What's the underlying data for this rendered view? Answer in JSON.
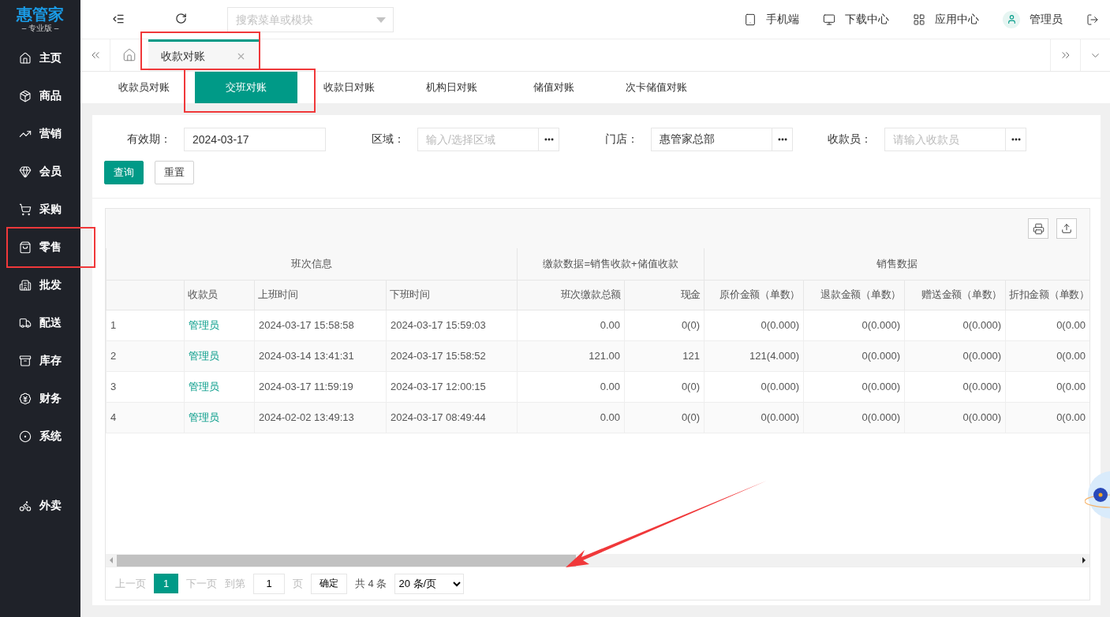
{
  "brand": {
    "name": "惠管家",
    "edition": "– 专业版 –"
  },
  "sidebar": {
    "items": [
      {
        "label": "主页",
        "highlighted": false
      },
      {
        "label": "商品",
        "highlighted": false
      },
      {
        "label": "营销",
        "highlighted": false
      },
      {
        "label": "会员",
        "highlighted": false
      },
      {
        "label": "采购",
        "highlighted": false
      },
      {
        "label": "零售",
        "highlighted": true
      },
      {
        "label": "批发",
        "highlighted": false
      },
      {
        "label": "配送",
        "highlighted": false
      },
      {
        "label": "库存",
        "highlighted": false
      },
      {
        "label": "财务",
        "highlighted": false
      },
      {
        "label": "系统",
        "highlighted": false
      },
      {
        "label": "外卖",
        "highlighted": false
      }
    ]
  },
  "topbar": {
    "search": {
      "placeholder": "搜索菜单或模块"
    },
    "links": [
      "手机端",
      "下载中心",
      "应用中心"
    ],
    "user": "管理员"
  },
  "page_tabs": [
    {
      "label": "收款对账",
      "selected": true,
      "highlighted": true
    }
  ],
  "sub_tabs": [
    {
      "label": "收款员对账",
      "selected": false,
      "highlighted": false
    },
    {
      "label": "交班对账",
      "selected": true,
      "highlighted": true
    },
    {
      "label": "收款日对账",
      "selected": false,
      "highlighted": false
    },
    {
      "label": "机构日对账",
      "selected": false,
      "highlighted": false
    },
    {
      "label": "储值对账",
      "selected": false,
      "highlighted": false
    },
    {
      "label": "次卡储值对账",
      "selected": false,
      "highlighted": false
    }
  ],
  "filters": [
    {
      "kind": "date",
      "label": "有效期：",
      "value": "2024-03-17"
    },
    {
      "kind": "picker",
      "label": "区域：",
      "placeholder": "输入/选择区域"
    },
    {
      "kind": "picker",
      "label": "门店：",
      "value": "惠管家总部"
    },
    {
      "kind": "picker",
      "label": "收款员：",
      "placeholder": "请输入收款员"
    }
  ],
  "actions": [
    {
      "label": "查询",
      "kind": "primary"
    },
    {
      "label": "重置",
      "kind": "default"
    }
  ],
  "table": {
    "groups": [
      {
        "label": "班次信息",
        "columns": [
          {
            "label": "收款员",
            "kind": "person"
          },
          {
            "label": "上班时间",
            "kind": "text"
          },
          {
            "label": "下班时间",
            "kind": "text"
          }
        ]
      },
      {
        "label": "缴款数据=销售收款+储值收款",
        "columns": [
          {
            "label": "班次缴款总额",
            "kind": "number"
          },
          {
            "label": "现金",
            "kind": "number"
          }
        ]
      },
      {
        "label": "销售数据",
        "columns": [
          {
            "label": "原价金额（单数）",
            "kind": "number"
          },
          {
            "label": "退款金额（单数）",
            "kind": "number"
          },
          {
            "label": "赠送金额（单数）",
            "kind": "number"
          },
          {
            "label": "折扣金额（单数）",
            "kind": "number"
          }
        ]
      }
    ],
    "rows": [
      {
        "number": "1",
        "cells": [
          "管理员",
          "2024-03-17 15:58:58",
          "2024-03-17 15:59:03",
          "0.00",
          "0(0)",
          "0(0.000)",
          "0(0.000)",
          "0(0.000)",
          "0(0.00"
        ]
      },
      {
        "number": "2",
        "cells": [
          "管理员",
          "2024-03-14 13:41:31",
          "2024-03-17 15:58:52",
          "121.00",
          "121",
          "121(4.000)",
          "0(0.000)",
          "0(0.000)",
          "0(0.00"
        ]
      },
      {
        "number": "3",
        "cells": [
          "管理员",
          "2024-03-17 11:59:19",
          "2024-03-17 12:00:15",
          "0.00",
          "0(0)",
          "0(0.000)",
          "0(0.000)",
          "0(0.000)",
          "0(0.00"
        ]
      },
      {
        "number": "4",
        "cells": [
          "管理员",
          "2024-02-02 13:49:13",
          "2024-03-17 08:49:44",
          "0.00",
          "0(0)",
          "0(0.000)",
          "0(0.000)",
          "0(0.000)",
          "0(0.00"
        ]
      }
    ],
    "scrollbar_annotated": true
  },
  "pagination": {
    "prev": "上一页",
    "pages": [
      {
        "label": "1",
        "selected": true
      }
    ],
    "next": "下一页",
    "goto_label": "到第",
    "goto_value": "1",
    "goto_unit": "页",
    "confirm": "确定",
    "total": "共 4 条",
    "page_size": "20 条/页"
  }
}
